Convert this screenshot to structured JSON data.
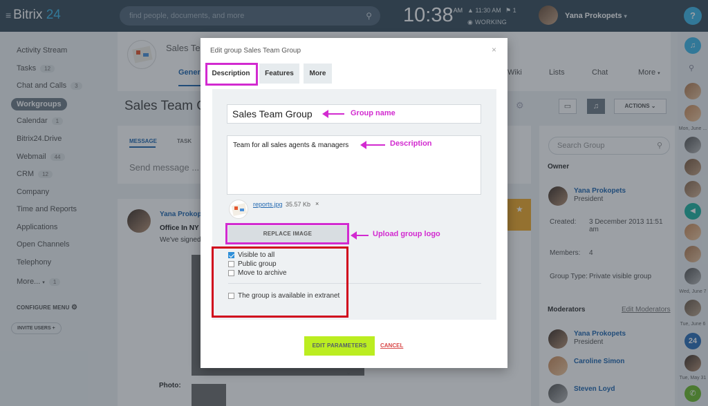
{
  "colors": {
    "topbar": "#3a4d5b",
    "accent": "#3fb7e8",
    "primary_button": "#bbed21",
    "annotation": "#d22ad0",
    "highlight_red": "#d0021b",
    "link": "#2067b0"
  },
  "topbar": {
    "logo_main": "Bitrix",
    "logo_num": "24",
    "search_placeholder": "find people, documents, and more",
    "clock": "10:38",
    "clock_ampm": "AM",
    "alarm": "11:30 AM",
    "flag_count": "1",
    "status": "WORKING",
    "user_name": "Yana Prokopets",
    "help": "?"
  },
  "sidebar": {
    "items": [
      {
        "label": "Activity Stream",
        "badge": null
      },
      {
        "label": "Tasks",
        "badge": "12"
      },
      {
        "label": "Chat and Calls",
        "badge": "3"
      },
      {
        "label": "Workgroups",
        "badge": null
      },
      {
        "label": "Calendar",
        "badge": "1"
      },
      {
        "label": "Bitrix24.Drive",
        "badge": null
      },
      {
        "label": "Webmail",
        "badge": "44"
      },
      {
        "label": "CRM",
        "badge": "12"
      },
      {
        "label": "Company",
        "badge": null
      },
      {
        "label": "Time and Reports",
        "badge": null
      },
      {
        "label": "Applications",
        "badge": null
      },
      {
        "label": "Open Channels",
        "badge": null
      },
      {
        "label": "Telephony",
        "badge": null
      },
      {
        "label": "More...",
        "badge": "1"
      }
    ],
    "configure_menu": "CONFIGURE MENU",
    "invite_users": "INVITE USERS"
  },
  "group": {
    "name_partial": "Sales Te",
    "title_partial": "Sales Team G",
    "tab_general": "Gener",
    "tabs_right": [
      "Wiki",
      "Lists",
      "Chat",
      "More"
    ],
    "actions": "ACTIONS",
    "msg_tab_message": "MESSAGE",
    "msg_tab_task": "TASK",
    "send_placeholder": "Send message ...",
    "post_author": "Yana Prokop",
    "post_title": "Office In NY",
    "post_text": "We've signed",
    "photo_label": "Photo:"
  },
  "right_panel": {
    "search_placeholder": "Search Group",
    "owner_heading": "Owner",
    "owner_name": "Yana Prokopets",
    "owner_role": "President",
    "created_label": "Created:",
    "created_value": "3 December 2013 11:51 am",
    "members_label": "Members:",
    "members_value": "4",
    "type_label": "Group Type:",
    "type_value": "Private visible group",
    "moderators_heading": "Moderators",
    "edit_moderators": "Edit Moderators",
    "moderators": [
      {
        "name": "Yana Prokopets",
        "role": "President"
      },
      {
        "name": "Caroline Simon",
        "role": ""
      },
      {
        "name": "Steven Loyd",
        "role": ""
      }
    ]
  },
  "far_bar": {
    "days": [
      "Mon, June ...",
      "Wed, June 7",
      "Tue, June 6",
      "Tue, May 31"
    ],
    "badge_24": "24"
  },
  "modal": {
    "title": "Edit group Sales Team Group",
    "close": "×",
    "tabs": [
      "Description",
      "Features",
      "More"
    ],
    "group_name_value": "Sales Team Group",
    "description_value": "Team for all sales agents & managers",
    "file_name": "reports.jpg",
    "file_size": "35.57 Kb",
    "file_remove": "×",
    "replace_image": "REPLACE IMAGE",
    "checkboxes": [
      {
        "label": "Visible to all",
        "checked": true
      },
      {
        "label": "Public group",
        "checked": false
      },
      {
        "label": "Move to archive",
        "checked": false
      },
      {
        "label": "The group is available in extranet",
        "checked": false
      }
    ],
    "edit_parameters": "EDIT PARAMETERS",
    "cancel": "CANCEL"
  },
  "annotations": {
    "group_name": "Group name",
    "description": "Description",
    "upload_logo": "Upload group logo"
  }
}
